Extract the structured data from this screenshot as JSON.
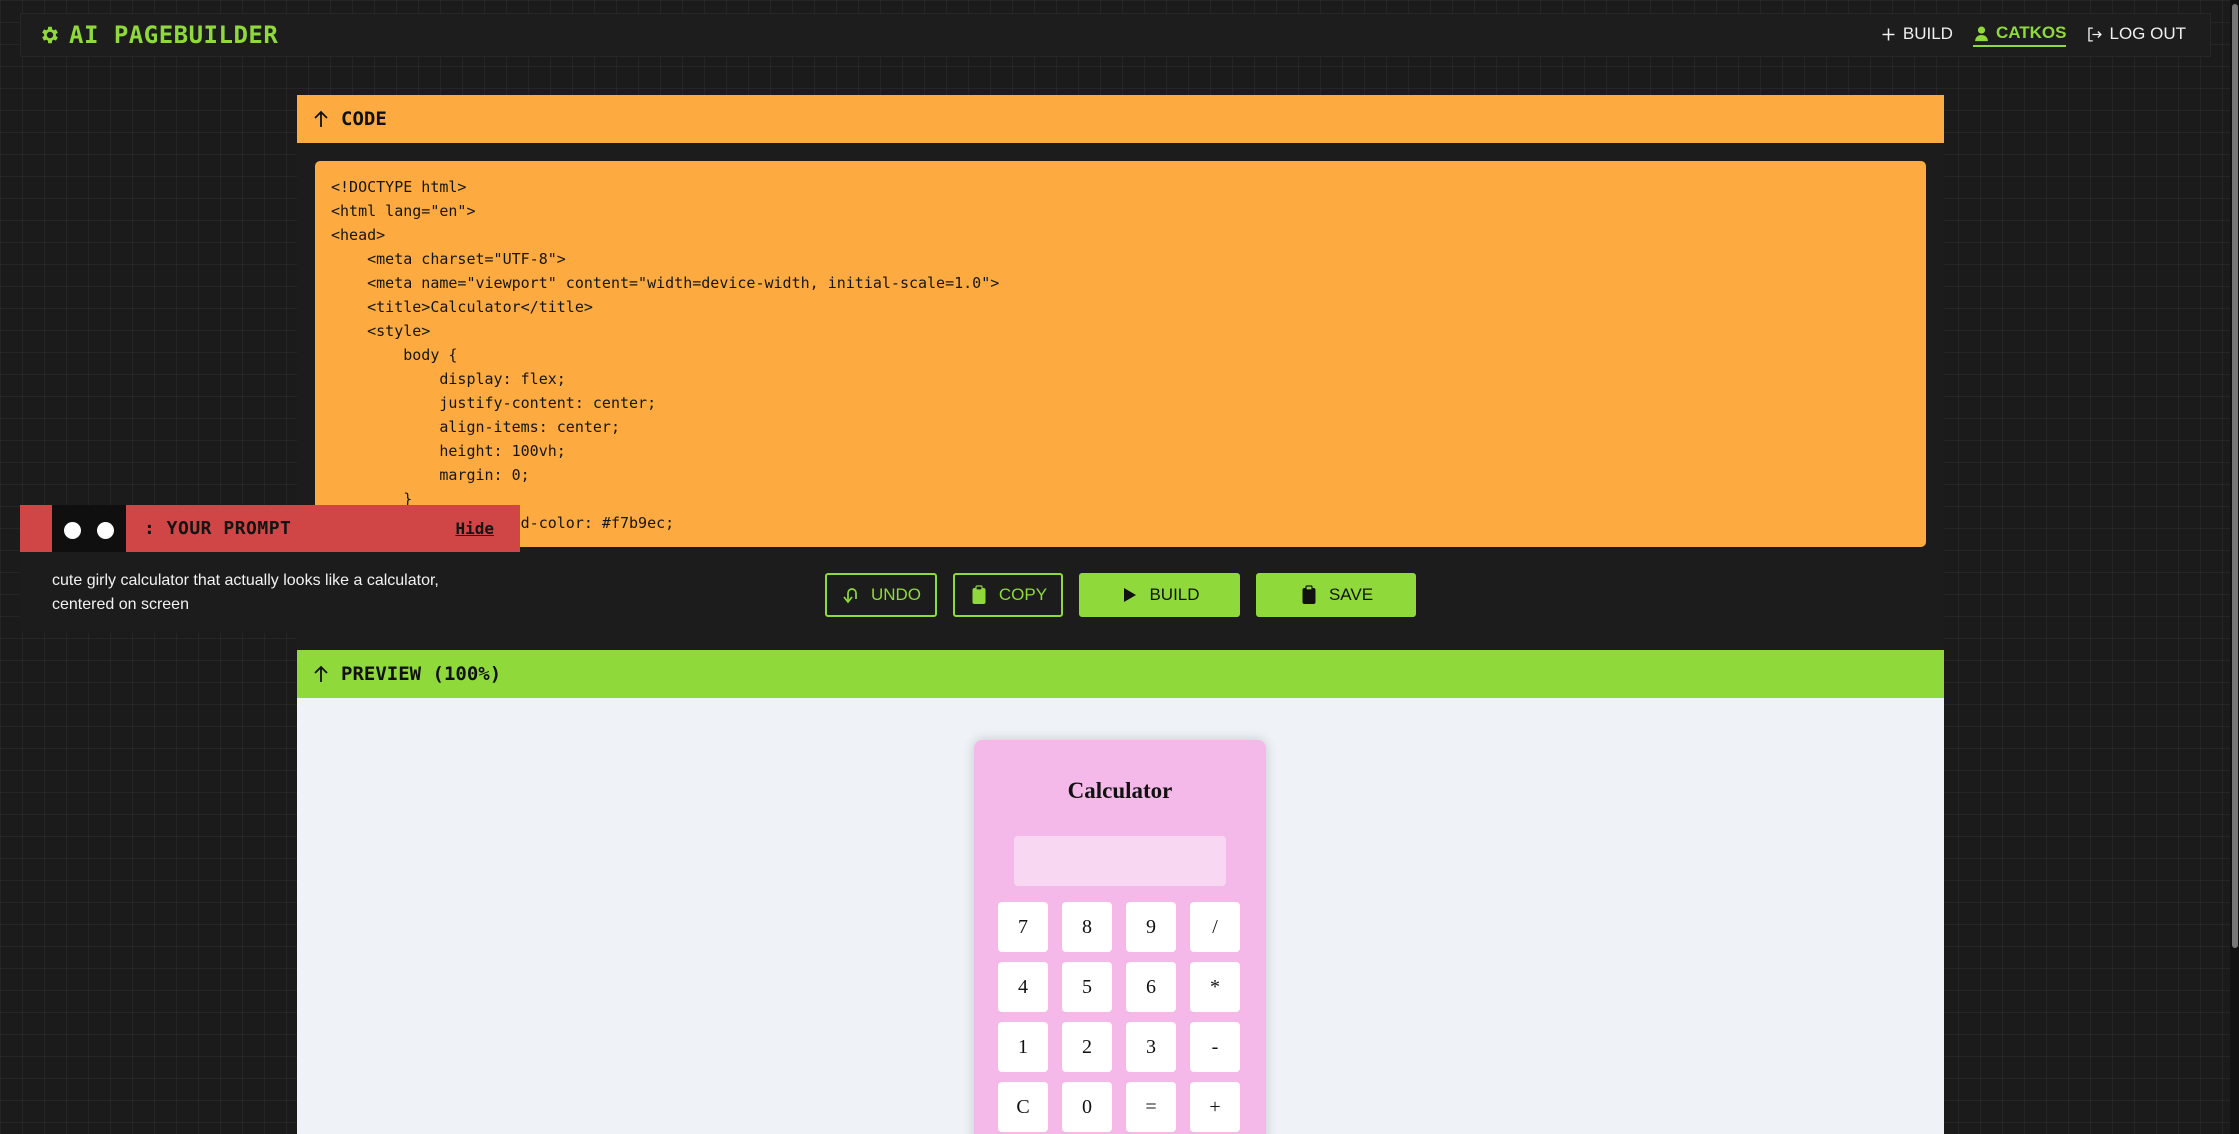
{
  "app": {
    "title": "AI PAGEBUILDER"
  },
  "nav": {
    "build": "BUILD",
    "user": "CATKOS",
    "logout": "LOG OUT"
  },
  "code": {
    "header": "CODE",
    "content": "<!DOCTYPE html>\n<html lang=\"en\">\n<head>\n    <meta charset=\"UTF-8\">\n    <meta name=\"viewport\" content=\"width=device-width, initial-scale=1.0\">\n    <title>Calculator</title>\n    <style>\n        body {\n            display: flex;\n            justify-content: center;\n            align-items: center;\n            height: 100vh;\n            margin: 0;\n        }\n            background-color: #f7b9ec;"
  },
  "actions": {
    "undo": "UNDO",
    "copy": "COPY",
    "build": "BUILD",
    "save": "SAVE"
  },
  "preview": {
    "header": "PREVIEW (100%)",
    "calculator": {
      "title": "Calculator",
      "display": "",
      "keys": [
        "7",
        "8",
        "9",
        "/",
        "4",
        "5",
        "6",
        "*",
        "1",
        "2",
        "3",
        "-",
        "C",
        "0",
        "=",
        "+"
      ]
    }
  },
  "prompt": {
    "title": ": YOUR PROMPT",
    "hide": "Hide",
    "text": "cute girly calculator that actually looks like a calculator, centered on screen"
  },
  "colors": {
    "accent": "#8fda3a",
    "code_bg": "#fdab40",
    "prompt_bg": "#d04545",
    "calc_bg": "#f5b9e9"
  }
}
